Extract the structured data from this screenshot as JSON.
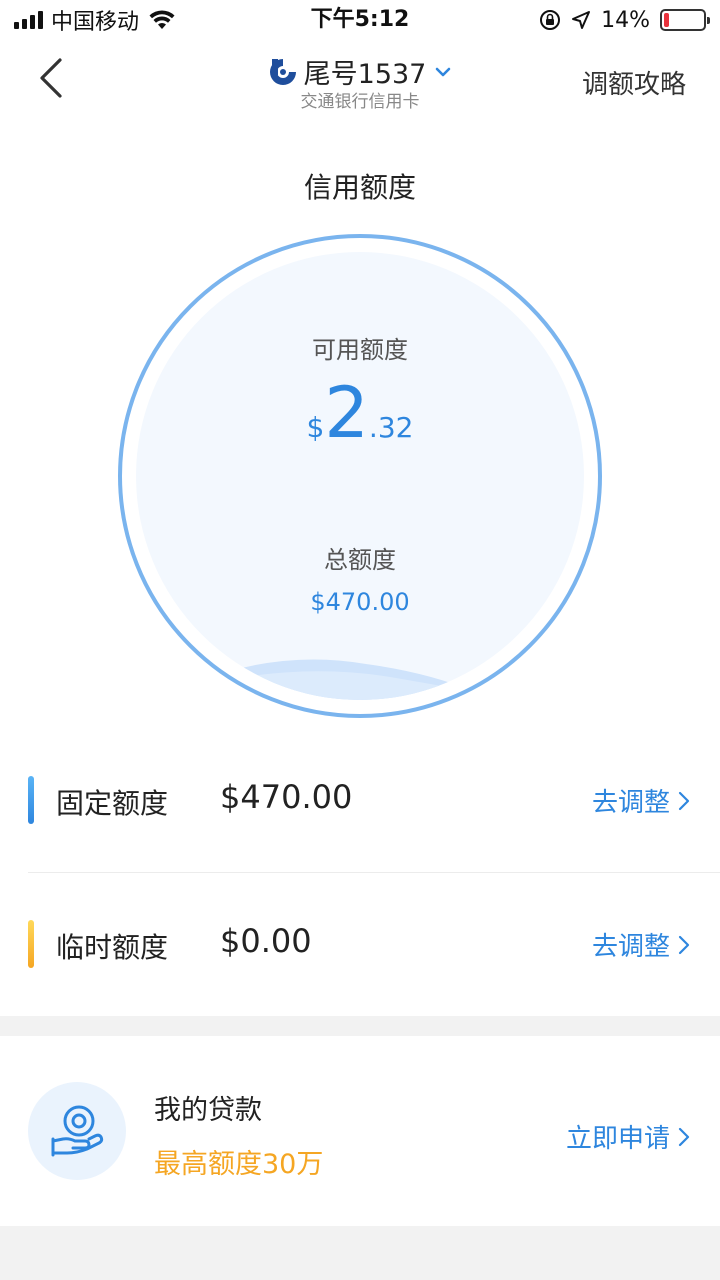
{
  "status_bar": {
    "carrier": "中国移动",
    "time": "下午5:12",
    "battery_pct": "14%",
    "battery_level": 0.14
  },
  "nav": {
    "title": "尾号1537",
    "subtitle": "交通银行信用卡",
    "right_link": "调额攻略"
  },
  "credit": {
    "section_title": "信用额度",
    "available_label": "可用额度",
    "available_currency": "$",
    "available_int": "2",
    "available_dec": ".32",
    "total_label": "总额度",
    "total_amount": "$470.00"
  },
  "limits": [
    {
      "label": "固定额度",
      "value": "$470.00",
      "action": "去调整",
      "accent": "#2e86de"
    },
    {
      "label": "临时额度",
      "value": "$0.00",
      "action": "去调整",
      "accent": "#f5a623"
    }
  ],
  "loan": {
    "title": "我的贷款",
    "subtitle": "最高额度30万",
    "action": "立即申请"
  },
  "colors": {
    "primary": "#2e86de",
    "accent_orange": "#f5a623",
    "circle_ring": "#7ab4ee",
    "battery_low": "#e8323c"
  },
  "icons": {
    "back": "chevron-left-icon",
    "bank_logo": "bank-logo-icon",
    "dropdown": "chevron-down-icon",
    "row_action": "chevron-right-icon",
    "loan": "hand-coin-icon"
  }
}
